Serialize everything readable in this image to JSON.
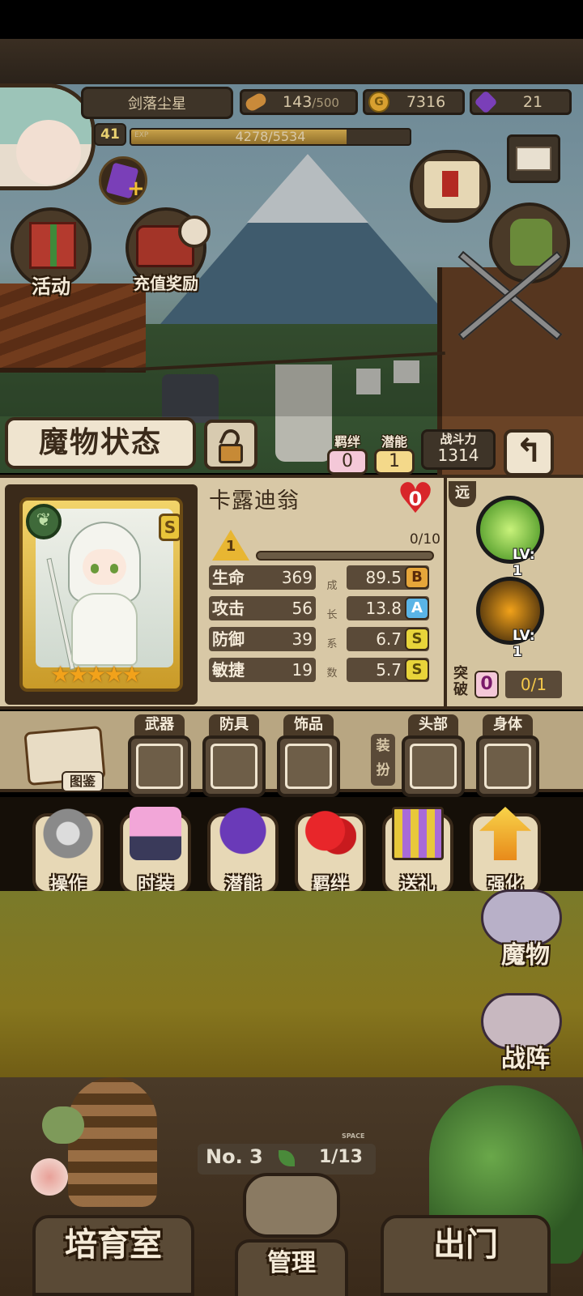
{
  "player": {
    "name": "剑落尘星",
    "level": "41",
    "exp_tag": "EXP",
    "exp_text": "4278/5534",
    "exp_fraction": 0.773
  },
  "resources": {
    "stamina": {
      "value": "143",
      "max": "/500",
      "icon": "bread-icon"
    },
    "gold": {
      "value": "7316",
      "icon": "gold-coin-icon",
      "glyph": "G"
    },
    "gems": {
      "value": "21",
      "icon": "purple-gem-icon"
    }
  },
  "hud_buttons": {
    "event_label": "活动",
    "recharge_label": "充值奖励"
  },
  "status_panel": {
    "title": "魔物状态",
    "bond": {
      "label": "羁绊",
      "value": "0"
    },
    "potential": {
      "label": "潜能",
      "value": "1"
    },
    "power": {
      "label": "战斗力",
      "value": "1314"
    },
    "back_glyph": "↰"
  },
  "monster": {
    "name": "卡露迪翁",
    "heart_value": "0",
    "rank": "S",
    "star_count": 5,
    "stars": "★★★★★",
    "element_icon": "leaf-icon",
    "level": "1",
    "level_progress": "0/10",
    "range": "远",
    "growth_label": [
      "成",
      "长",
      "系",
      "数"
    ],
    "stats": [
      {
        "name": "生命",
        "value": "369",
        "growth": "89.5",
        "grade": "B"
      },
      {
        "name": "攻击",
        "value": "56",
        "growth": "13.8",
        "grade": "A"
      },
      {
        "name": "防御",
        "value": "39",
        "growth": "6.7",
        "grade": "S"
      },
      {
        "name": "敏捷",
        "value": "19",
        "growth": "5.7",
        "grade": "S"
      }
    ],
    "skills": [
      {
        "level": "LV: 1",
        "icon": "green-wind-skill-icon"
      },
      {
        "level": "LV: 1",
        "icon": "fire-sword-skill-icon"
      }
    ],
    "breakthrough": {
      "label": "突破",
      "count": "0",
      "progress": "0/1"
    }
  },
  "equipment": {
    "codex_label": "图鉴",
    "slots": [
      "武器",
      "防具",
      "饰品",
      "头部",
      "身体"
    ],
    "decor_label": "装扮"
  },
  "actions": [
    {
      "label": "操作",
      "icon": "gear-icon"
    },
    {
      "label": "时装",
      "icon": "dress-icon"
    },
    {
      "label": "潜能",
      "icon": "shadow-spirit-icon"
    },
    {
      "label": "羁绊",
      "icon": "hearts-icon"
    },
    {
      "label": "送礼",
      "icon": "gift-icon"
    },
    {
      "label": "强化",
      "icon": "upgrade-arrow-icon"
    }
  ],
  "side_nav": {
    "monsters_label": "魔物",
    "formation_label": "战阵"
  },
  "room": {
    "number": "No. 3",
    "count": "1/13",
    "space_tag": "SPACE"
  },
  "bottom_nav": {
    "nursery_label": "培育室",
    "manage_label": "管理",
    "exit_label": "出门"
  }
}
